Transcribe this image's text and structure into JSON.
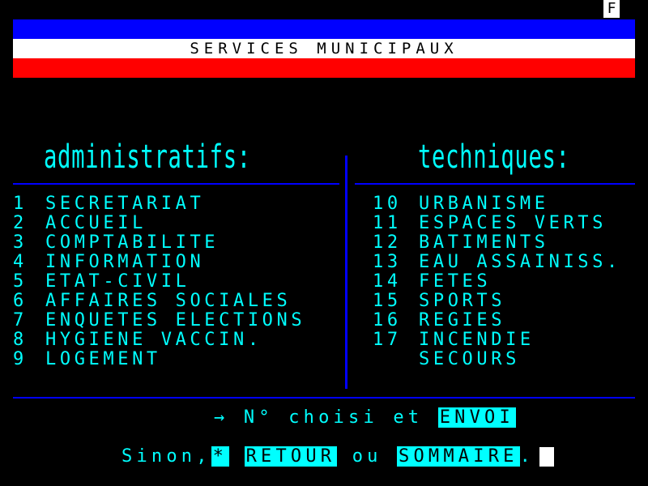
{
  "colors": {
    "cyan": "#00ffff",
    "blue": "#0000ff",
    "red": "#ff0000",
    "white": "#ffffff",
    "black": "#000000"
  },
  "status": {
    "indicator": "F"
  },
  "banner": {
    "title": "SERVICES MUNICIPAUX"
  },
  "left_column": {
    "heading": "administratifs:",
    "items": [
      {
        "num": "1",
        "label": "SECRETARIAT"
      },
      {
        "num": "2",
        "label": "ACCUEIL"
      },
      {
        "num": "3",
        "label": "COMPTABILITE"
      },
      {
        "num": "4",
        "label": "INFORMATION"
      },
      {
        "num": "5",
        "label": "ETAT-CIVIL"
      },
      {
        "num": "6",
        "label": "AFFAIRES SOCIALES"
      },
      {
        "num": "7",
        "label": "ENQUETES ELECTIONS"
      },
      {
        "num": "8",
        "label": "HYGIENE VACCIN."
      },
      {
        "num": "9",
        "label": "LOGEMENT"
      }
    ]
  },
  "right_column": {
    "heading": "techniques:",
    "items": [
      {
        "num": "10",
        "label": "URBANISME"
      },
      {
        "num": "11",
        "label": "ESPACES VERTS"
      },
      {
        "num": "12",
        "label": "BATIMENTS"
      },
      {
        "num": "13",
        "label": "EAU ASSAINISS."
      },
      {
        "num": "14",
        "label": "FETES"
      },
      {
        "num": "15",
        "label": "SPORTS"
      },
      {
        "num": "16",
        "label": "REGIES"
      },
      {
        "num": "17",
        "label": "INCENDIE"
      },
      {
        "num": "",
        "label": "SECOURS"
      }
    ]
  },
  "footer": {
    "line1_text": "→ N° choisi et ",
    "envoi_key": "ENVOI",
    "line2_prefix": "Sinon,",
    "star_key": "*",
    "retour_key": "RETOUR",
    "ou_text": " ou ",
    "sommaire_key": "SOMMAIRE",
    "line2_suffix": "."
  }
}
